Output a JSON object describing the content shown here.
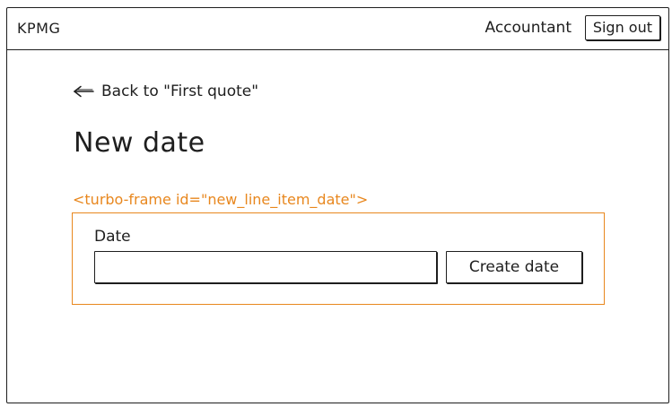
{
  "navbar": {
    "brand": "KPMG",
    "role": "Accountant",
    "signout_label": "Sign out"
  },
  "back_link": {
    "icon": "arrow-left-icon",
    "label": "Back to \"First quote\""
  },
  "page": {
    "title": "New date"
  },
  "turbo_frame": {
    "label": "<turbo-frame id=\"new_line_item_date\">",
    "accent_color": "#e8871e"
  },
  "form": {
    "date_label": "Date",
    "date_value": "",
    "submit_label": "Create date"
  }
}
